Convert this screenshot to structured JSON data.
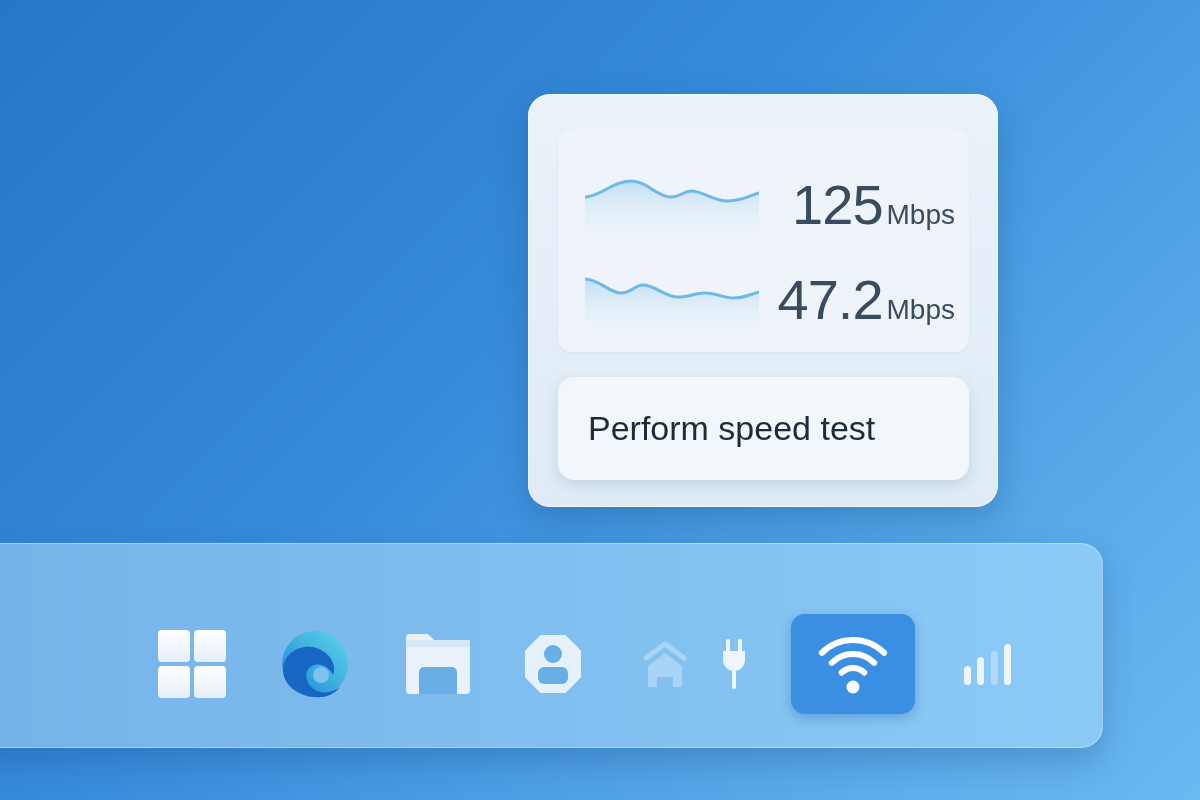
{
  "flyout": {
    "speeds": [
      {
        "value": "125",
        "unit": "Mbps"
      },
      {
        "value": "47.2",
        "unit": "Mbps"
      }
    ],
    "button": "Perform speed test"
  },
  "taskbar": {
    "items": [
      {
        "kind": "start",
        "selected": false,
        "disabled": false
      },
      {
        "kind": "browser",
        "selected": false,
        "disabled": false
      },
      {
        "kind": "folder",
        "selected": false,
        "disabled": false
      },
      {
        "kind": "contact",
        "selected": false,
        "disabled": false
      },
      {
        "kind": "home",
        "selected": false,
        "disabled": true
      },
      {
        "kind": "power",
        "selected": false,
        "disabled": false
      },
      {
        "kind": "wifi",
        "selected": true,
        "disabled": false
      },
      {
        "kind": "signal",
        "selected": false,
        "disabled": false
      }
    ]
  }
}
